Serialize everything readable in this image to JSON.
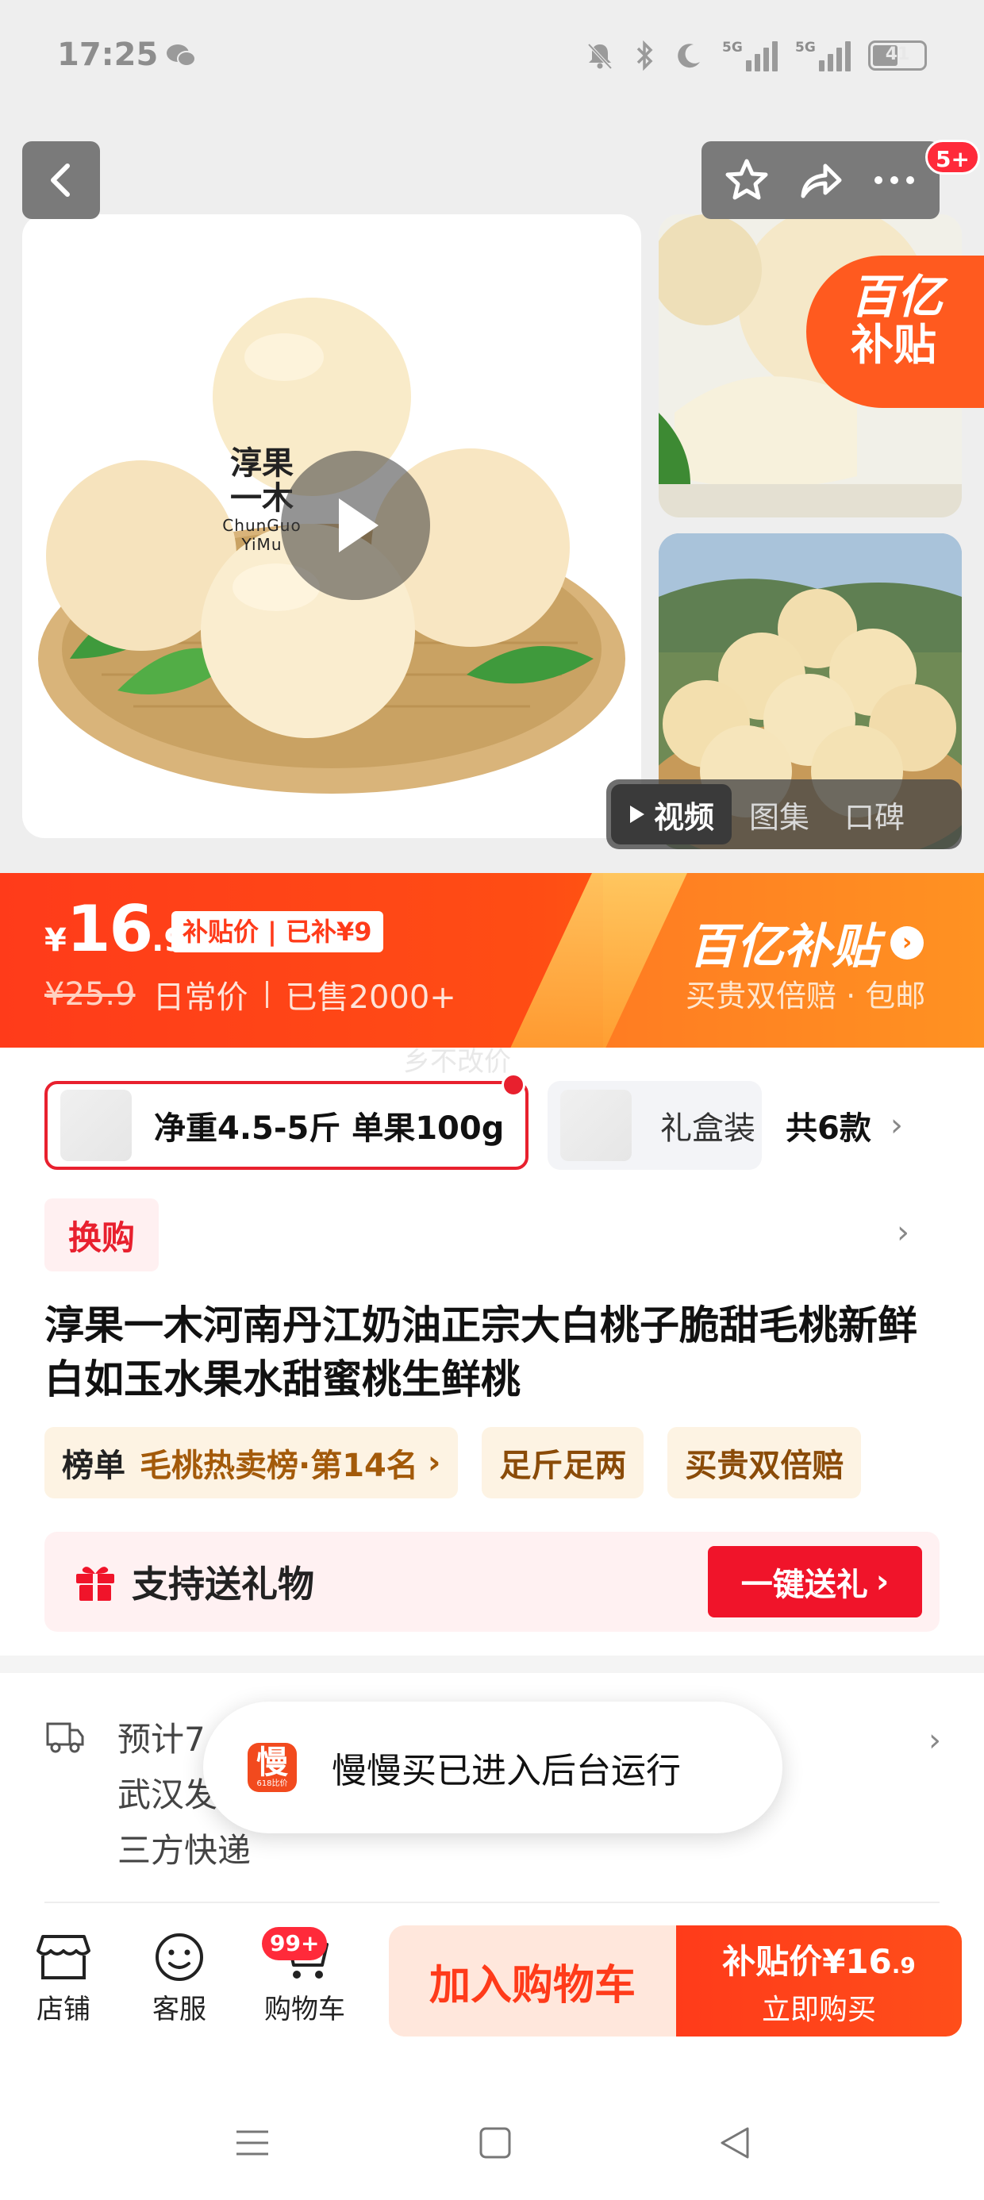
{
  "status_bar": {
    "time": "17:25",
    "sig1_label": "5G",
    "sig2_label": "5G",
    "battery": "41"
  },
  "top_actions": {
    "badge": "5+"
  },
  "gallery": {
    "brand_cn": "淳果\n一木",
    "brand_en": "ChunGuo YiMu",
    "subsidy_line1": "百亿",
    "subsidy_line2": "补贴",
    "media_tabs": [
      "视频",
      "图集",
      "口碑"
    ]
  },
  "price": {
    "currency": "¥",
    "integer": "16",
    "decimal": ".9",
    "subsidy_tag": "补贴价 | 已补¥9",
    "original": "¥25.9",
    "daily_label": "日常价",
    "sold": "已售2000+",
    "program_title": "百亿补贴",
    "program_sub": "买贵双倍赔 · 包邮"
  },
  "overlay_text": "乡不改价",
  "sku": {
    "selected": "净重4.5-5斤 单果100g",
    "other": "礼盒装",
    "count": "共6款"
  },
  "swap_label": "换购",
  "title": "淳果一木河南丹江奶油正宗大白桃子脆甜毛桃新鲜白如玉水果水甜蜜桃生鲜桃",
  "tags": {
    "rank_key": "榜单",
    "rank_value": "毛桃热卖榜·第14名",
    "tag2": "足斤足两",
    "tag3": "买贵双倍赔"
  },
  "gift": {
    "text": "支持送礼物",
    "button": "一键送礼"
  },
  "shipping": {
    "line1": "预计7",
    "line2": "武汉发",
    "line3": "三方快递"
  },
  "toast": {
    "logo_char": "慢",
    "logo_small": "618比价",
    "message": "慢慢买已进入后台运行"
  },
  "bottom_nav": {
    "shop": "店铺",
    "service": "客服",
    "cart": "购物车",
    "cart_badge": "99+",
    "add_to_cart": "加入购物车",
    "buy_label": "补贴价¥16",
    "buy_decimal": ".9",
    "buy_now": "立即购买"
  },
  "colors": {
    "accent_red": "#ff3b1a",
    "subsidy_orange": "#ff7a0a",
    "gift_red": "#f0142a"
  }
}
